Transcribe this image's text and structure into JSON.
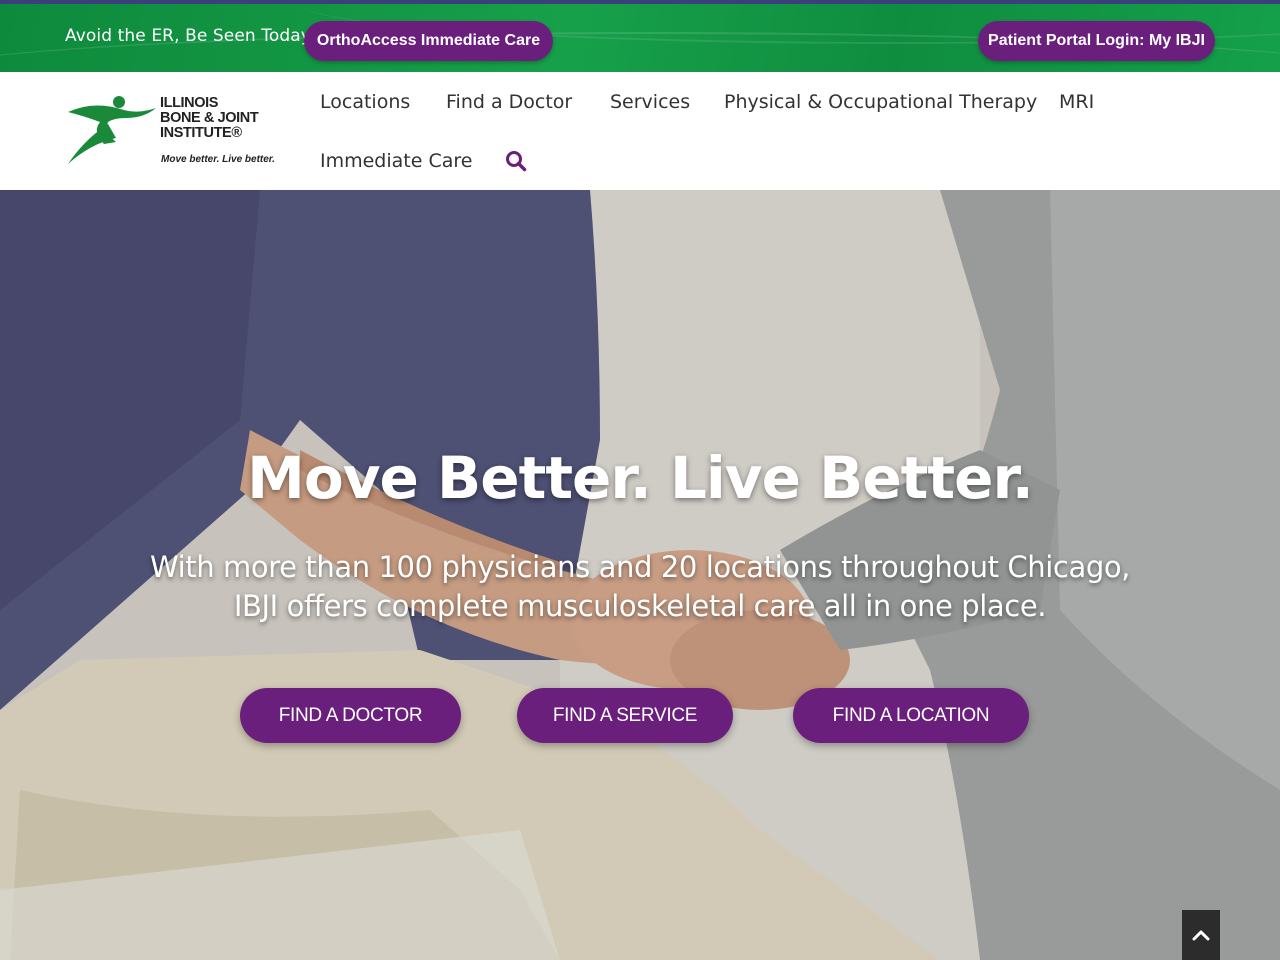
{
  "topbar": {
    "tagline": "Avoid the ER, Be Seen Today",
    "ortho_button": "OrthoAccess Immediate Care",
    "portal_button": "Patient Portal Login: My IBJI"
  },
  "logo": {
    "line1": "ILLINOIS",
    "line2": "BONE & JOINT",
    "line3": "INSTITUTE®",
    "slogan": "Move better. Live better."
  },
  "nav": {
    "items": [
      {
        "label": "Locations"
      },
      {
        "label": "Find a Doctor"
      },
      {
        "label": "Services"
      },
      {
        "label": "Physical & Occupational Therapy"
      },
      {
        "label": "MRI"
      },
      {
        "label": "Immediate Care"
      }
    ],
    "search_icon": "search-icon"
  },
  "hero": {
    "title": "Move Better. Live Better.",
    "subtitle_line1": "With more than 100 physicians and 20 locations throughout Chicago,",
    "subtitle_line2": "IBJI offers complete musculoskeletal care all in one place.",
    "buttons": {
      "doctor": "FIND A DOCTOR",
      "service": "FIND A SERVICE",
      "location": "FIND A LOCATION"
    }
  },
  "scroll_top_icon": "chevron-up-icon",
  "colors": {
    "green": "#17a04a",
    "purple": "#6b1f7c",
    "nav_text": "#333333"
  }
}
